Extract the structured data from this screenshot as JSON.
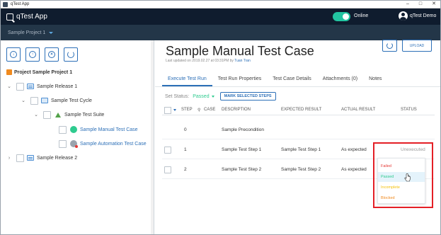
{
  "window": {
    "title": "qTest App",
    "controls": [
      "–",
      "□",
      "✕"
    ]
  },
  "appbar": {
    "brand": "qTest App",
    "online_label": "Online",
    "user_name": "qTest Demo"
  },
  "projectbar": {
    "project_name": "Sample Project 1"
  },
  "toolbar": {
    "icons": [
      "download-icon",
      "upload-icon",
      "cancel-icon",
      "refresh-icon"
    ]
  },
  "tree": {
    "project": "Project Sample Project 1",
    "release1": "Sample Release 1",
    "cycle": "Sample Test Cycle",
    "suite": "Sample Test Suite",
    "case1": "Sample Manual Test Case",
    "case2": "Sample Automation Test Case",
    "release2": "Sample Release 2"
  },
  "testcase": {
    "title": "Sample Manual Test Case",
    "updated_prefix": "Last updated on 2019.02.27 at 03:31PM by ",
    "updated_by": "Tuan Tran",
    "upload_label": "UPLOAD"
  },
  "tabs": [
    "Execute Test Run",
    "Test Run Properties",
    "Test Case Details",
    "Attachments (0)",
    "Notes"
  ],
  "status_bar": {
    "label": "Set Status:",
    "value": "Passed",
    "mark_button": "MARK SELECTED STEPS"
  },
  "columns": {
    "step": "STEP",
    "case": "CASE",
    "description": "DESCRIPTION",
    "expected": "EXPECTED RESULT",
    "actual": "ACTUAL RESULT",
    "status": "STATUS"
  },
  "rows": [
    {
      "step": "0",
      "description": "Sample Precondition",
      "expected": "",
      "actual": "",
      "status": ""
    },
    {
      "step": "1",
      "description": "Sample Test Step 1",
      "expected": "Sample Test Step 1",
      "actual": "As expected",
      "status": "Unexecuted"
    },
    {
      "step": "2",
      "description": "Sample Test Step 2",
      "expected": "Sample Test Step 2",
      "actual": "As expected",
      "status": ""
    }
  ],
  "status_options": [
    "Failed",
    "Passed",
    "Incomplete",
    "Blocked"
  ],
  "colors": {
    "accent": "#2c6fb7",
    "passed": "#2ecb8f",
    "failed": "#e53935",
    "incomplete": "#f4c20d",
    "blocked": "#f08a1f",
    "highlight": "#e41f26"
  }
}
